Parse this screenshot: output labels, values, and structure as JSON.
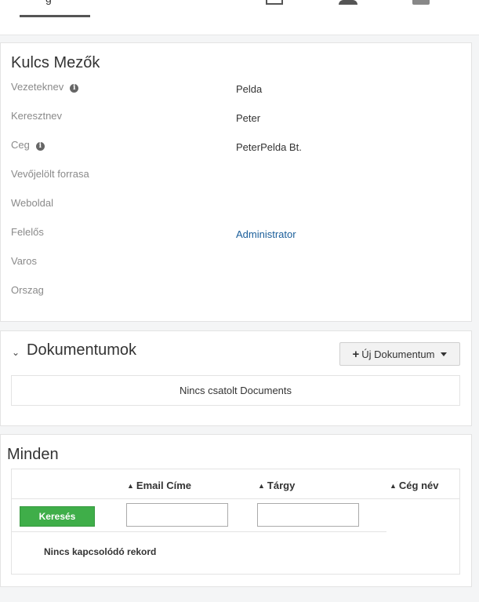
{
  "top_nav": {
    "active_tab_label": "g",
    "icons": [
      "calendar-icon",
      "user-icon",
      "document-icon"
    ]
  },
  "key_fields": {
    "title": "Kulcs Mezők",
    "fields": [
      {
        "label": "Vezeteknev",
        "value": "Pelda",
        "has_info": true
      },
      {
        "label": "Keresztnev",
        "value": "Peter",
        "has_info": false
      },
      {
        "label": "Ceg",
        "value": "PeterPelda Bt.",
        "has_info": true
      },
      {
        "label": "Vevőjelölt forrasa",
        "value": "",
        "has_info": false
      },
      {
        "label": "Weboldal",
        "value": "",
        "has_info": false
      },
      {
        "label": "Felelős",
        "value": "Administrator",
        "has_info": false,
        "is_link": true
      },
      {
        "label": "Varos",
        "value": "",
        "has_info": false
      },
      {
        "label": "Orszag",
        "value": "",
        "has_info": false
      }
    ]
  },
  "documents": {
    "title": "Dokumentumok",
    "new_button_label": "Új Dokumentum",
    "empty_text": "Nincs csatolt Documents"
  },
  "all_section": {
    "title": "Minden",
    "columns": [
      "Email Címe",
      "Tárgy",
      "Cég név"
    ],
    "search_button": "Keresés",
    "empty_text": "Nincs kapcsolódó rekord"
  },
  "colors": {
    "link": "#1a5e9a",
    "search_button": "#3fae49"
  }
}
